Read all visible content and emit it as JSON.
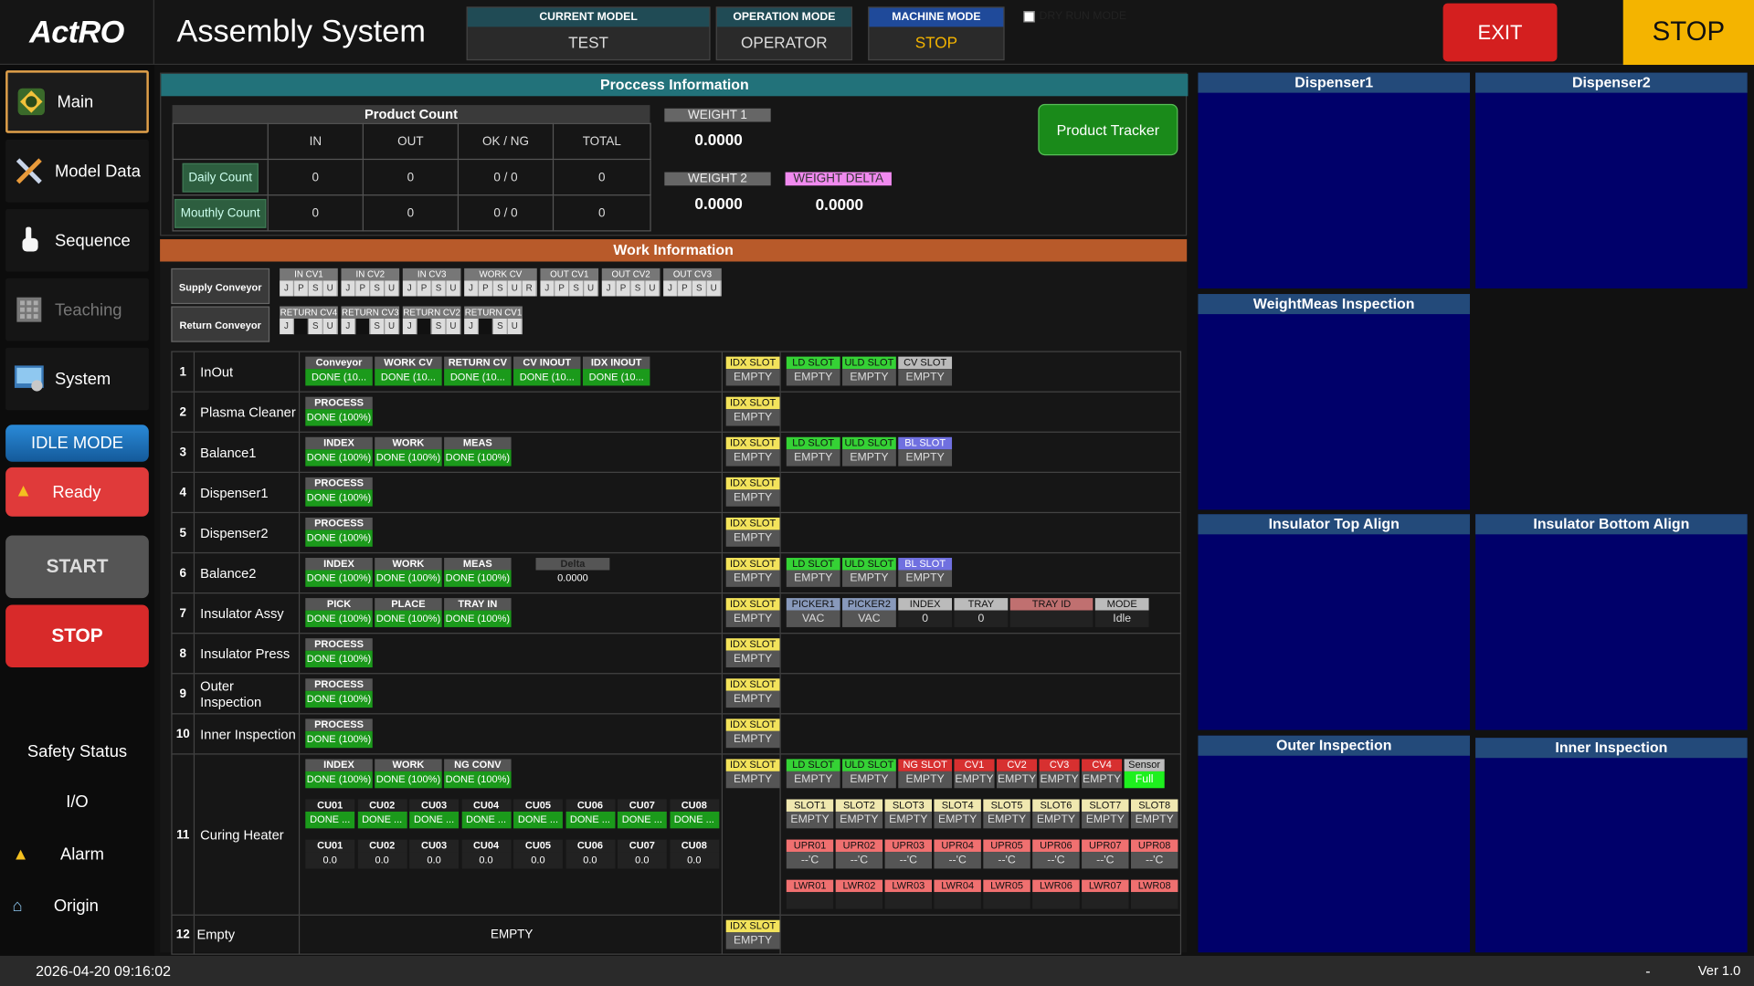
{
  "header": {
    "logo": "ActRO",
    "title": "Assembly System",
    "current_model_label": "CURRENT MODEL",
    "current_model": "TEST",
    "operation_mode_label": "OPERATION MODE",
    "operation_mode": "OPERATOR",
    "machine_mode_label": "MACHINE MODE",
    "machine_mode": "STOP",
    "dry_run_label": "DRY RUN MODE",
    "exit_label": "EXIT",
    "stop_label": "STOP"
  },
  "sidebar": {
    "items": [
      {
        "label": "Main",
        "icon": "main-icon"
      },
      {
        "label": "Model Data",
        "icon": "tools-icon"
      },
      {
        "label": "Sequence",
        "icon": "hand-pointer-icon"
      },
      {
        "label": "Teaching",
        "icon": "keypad-icon"
      },
      {
        "label": "System",
        "icon": "system-icon"
      }
    ],
    "idle_mode": "IDLE MODE",
    "ready": "Ready",
    "start": "START",
    "stop": "STOP",
    "bottom": [
      {
        "label": "Safety Status"
      },
      {
        "label": "I/O"
      },
      {
        "label": "Alarm"
      },
      {
        "label": "Origin"
      }
    ]
  },
  "process": {
    "title": "Proccess Information",
    "product_count": {
      "title": "Product Count",
      "cols": [
        "IN",
        "OUT",
        "OK / NG",
        "TOTAL"
      ],
      "rows": [
        {
          "label": "Daily Count",
          "values": [
            "0",
            "0",
            "0 / 0",
            "0"
          ]
        },
        {
          "label": "Mouthly Count",
          "values": [
            "0",
            "0",
            "0 / 0",
            "0"
          ]
        }
      ]
    },
    "weight1_label": "WEIGHT 1",
    "weight1": "0.0000",
    "weight2_label": "WEIGHT 2",
    "weight2": "0.0000",
    "delta_label": "WEIGHT DELTA",
    "delta": "0.0000",
    "tracker": "Product Tracker"
  },
  "work": {
    "title": "Work Information",
    "supply_label": "Supply Conveyor",
    "return_label": "Return Conveyor",
    "supply": [
      {
        "name": "IN CV1",
        "cells": [
          "J",
          "P",
          "S",
          "U"
        ]
      },
      {
        "name": "IN CV2",
        "cells": [
          "J",
          "P",
          "S",
          "U"
        ]
      },
      {
        "name": "IN CV3",
        "cells": [
          "J",
          "P",
          "S",
          "U"
        ]
      },
      {
        "name": "WORK CV",
        "cells": [
          "J",
          "P",
          "S",
          "U",
          "R"
        ]
      },
      {
        "name": "OUT CV1",
        "cells": [
          "J",
          "P",
          "S",
          "U"
        ]
      },
      {
        "name": "OUT CV2",
        "cells": [
          "J",
          "P",
          "S",
          "U"
        ]
      },
      {
        "name": "OUT CV3",
        "cells": [
          "J",
          "P",
          "S",
          "U"
        ]
      }
    ],
    "ret": [
      {
        "name": "RETURN CV4",
        "cells": [
          "J",
          "",
          "S",
          "U"
        ]
      },
      {
        "name": "RETURN CV3",
        "cells": [
          "J",
          "",
          "S",
          "U"
        ]
      },
      {
        "name": "RETURN CV2",
        "cells": [
          "J",
          "",
          "S",
          "U"
        ]
      },
      {
        "name": "RETURN CV1",
        "cells": [
          "J",
          "",
          "S",
          "U"
        ]
      }
    ],
    "rows": [
      {
        "num": "1",
        "name": "InOut",
        "steps": [
          {
            "n": "Conveyor",
            "v": "DONE (10..."
          },
          {
            "n": "WORK CV",
            "v": "DONE (10..."
          },
          {
            "n": "RETURN CV",
            "v": "DONE (10..."
          },
          {
            "n": "CV INOUT",
            "v": "DONE (10..."
          },
          {
            "n": "IDX INOUT",
            "v": "DONE (10..."
          }
        ],
        "idx": "EMPTY",
        "slots": [
          {
            "n": "LD SLOT",
            "v": "EMPTY",
            "c": "g"
          },
          {
            "n": "ULD SLOT",
            "v": "EMPTY",
            "c": "g"
          },
          {
            "n": "CV SLOT",
            "v": "EMPTY",
            "c": "gr"
          }
        ]
      },
      {
        "num": "2",
        "name": "Plasma Cleaner",
        "steps": [
          {
            "n": "PROCESS",
            "v": "DONE (100%)"
          }
        ],
        "idx": "EMPTY",
        "slots": []
      },
      {
        "num": "3",
        "name": "Balance1",
        "steps": [
          {
            "n": "INDEX",
            "v": "DONE (100%)"
          },
          {
            "n": "WORK",
            "v": "DONE (100%)"
          },
          {
            "n": "MEAS",
            "v": "DONE (100%)"
          }
        ],
        "idx": "EMPTY",
        "slots": [
          {
            "n": "LD SLOT",
            "v": "EMPTY",
            "c": "g"
          },
          {
            "n": "ULD SLOT",
            "v": "EMPTY",
            "c": "g"
          },
          {
            "n": "BL SLOT",
            "v": "EMPTY",
            "c": "pu"
          }
        ]
      },
      {
        "num": "4",
        "name": "Dispenser1",
        "steps": [
          {
            "n": "PROCESS",
            "v": "DONE (100%)"
          }
        ],
        "idx": "EMPTY",
        "slots": []
      },
      {
        "num": "5",
        "name": "Dispenser2",
        "steps": [
          {
            "n": "PROCESS",
            "v": "DONE (100%)"
          }
        ],
        "idx": "EMPTY",
        "slots": []
      },
      {
        "num": "6",
        "name": "Balance2",
        "steps": [
          {
            "n": "INDEX",
            "v": "DONE (100%)"
          },
          {
            "n": "WORK",
            "v": "DONE (100%)"
          },
          {
            "n": "MEAS",
            "v": "DONE (100%)"
          }
        ],
        "delta": {
          "n": "Delta",
          "v": "0.0000"
        },
        "idx": "EMPTY",
        "slots": [
          {
            "n": "LD SLOT",
            "v": "EMPTY",
            "c": "g"
          },
          {
            "n": "ULD SLOT",
            "v": "EMPTY",
            "c": "g"
          },
          {
            "n": "BL SLOT",
            "v": "EMPTY",
            "c": "pu"
          }
        ]
      },
      {
        "num": "7",
        "name": "Insulator Assy",
        "steps": [
          {
            "n": "PICK",
            "v": "DONE (100%)"
          },
          {
            "n": "PLACE",
            "v": "DONE (100%)"
          },
          {
            "n": "TRAY IN",
            "v": "DONE (100%)"
          }
        ],
        "idx": "EMPTY",
        "slots": [
          {
            "n": "PICKER1",
            "v": "VAC",
            "c": "lb"
          },
          {
            "n": "PICKER2",
            "v": "VAC",
            "c": "lb"
          },
          {
            "n": "INDEX",
            "v": "0",
            "c": "gr"
          },
          {
            "n": "TRAY",
            "v": "0",
            "c": "gr"
          },
          {
            "n": "TRAY ID",
            "v": "",
            "c": "br"
          },
          {
            "n": "MODE",
            "v": "Idle",
            "c": "gr"
          }
        ]
      },
      {
        "num": "8",
        "name": "Insulator Press",
        "steps": [
          {
            "n": "PROCESS",
            "v": "DONE (100%)"
          }
        ],
        "idx": "EMPTY",
        "slots": []
      },
      {
        "num": "9",
        "name": "Outer Inspection",
        "steps": [
          {
            "n": "PROCESS",
            "v": "DONE (100%)"
          }
        ],
        "idx": "EMPTY",
        "slots": []
      },
      {
        "num": "10",
        "name": "Inner Inspection",
        "steps": [
          {
            "n": "PROCESS",
            "v": "DONE (100%)"
          }
        ],
        "idx": "EMPTY",
        "slots": []
      }
    ],
    "curing": {
      "num": "11",
      "name": "Curing Heater",
      "steps": [
        {
          "n": "INDEX",
          "v": "DONE (100%)"
        },
        {
          "n": "WORK",
          "v": "DONE (100%)"
        },
        {
          "n": "NG CONV",
          "v": "DONE (100%)"
        }
      ],
      "idx": "EMPTY",
      "slots": [
        {
          "n": "LD SLOT",
          "v": "EMPTY",
          "c": "g"
        },
        {
          "n": "ULD SLOT",
          "v": "EMPTY",
          "c": "g"
        },
        {
          "n": "NG SLOT",
          "v": "EMPTY",
          "c": "rd"
        },
        {
          "n": "CV1",
          "v": "EMPTY",
          "c": "rd"
        },
        {
          "n": "CV2",
          "v": "EMPTY",
          "c": "rd"
        },
        {
          "n": "CV3",
          "v": "EMPTY",
          "c": "rd"
        },
        {
          "n": "CV4",
          "v": "EMPTY",
          "c": "rd"
        },
        {
          "n": "Sensor",
          "v": "Full",
          "c": "gr"
        }
      ],
      "cu_a": [
        "CU01",
        "CU02",
        "CU03",
        "CU04",
        "CU05",
        "CU06",
        "CU07",
        "CU08"
      ],
      "cu_a_v": [
        "DONE ...",
        "DONE ...",
        "DONE ...",
        "DONE ...",
        "DONE ...",
        "DONE ...",
        "DONE ...",
        "DONE ..."
      ],
      "cu_b_v": [
        "0.0",
        "0.0",
        "0.0",
        "0.0",
        "0.0",
        "0.0",
        "0.0",
        "0.0"
      ],
      "slot_n": [
        "SLOT1",
        "SLOT2",
        "SLOT3",
        "SLOT4",
        "SLOT5",
        "SLOT6",
        "SLOT7",
        "SLOT8"
      ],
      "slot_v": [
        "EMPTY",
        "EMPTY",
        "EMPTY",
        "EMPTY",
        "EMPTY",
        "EMPTY",
        "EMPTY",
        "EMPTY"
      ],
      "upr_n": [
        "UPR01",
        "UPR02",
        "UPR03",
        "UPR04",
        "UPR05",
        "UPR06",
        "UPR07",
        "UPR08"
      ],
      "upr_v": [
        "--'C",
        "--'C",
        "--'C",
        "--'C",
        "--'C",
        "--'C",
        "--'C",
        "--'C"
      ],
      "lwr_n": [
        "LWR01",
        "LWR02",
        "LWR03",
        "LWR04",
        "LWR05",
        "LWR06",
        "LWR07",
        "LWR08"
      ]
    },
    "empty_row": {
      "num": "12",
      "name": "Empty",
      "text": "EMPTY",
      "idx": "EMPTY"
    },
    "idx_label": "IDX SLOT"
  },
  "panels": [
    "Dispenser1",
    "Dispenser2",
    "WeightMeas Inspection",
    "Insulator Top Align",
    "Insulator Bottom Align",
    "Outer Inspection",
    "Inner Inspection"
  ],
  "footer": {
    "datetime": "2026-04-20 09:16:02",
    "dash": "-",
    "version": "Ver 1.0"
  }
}
